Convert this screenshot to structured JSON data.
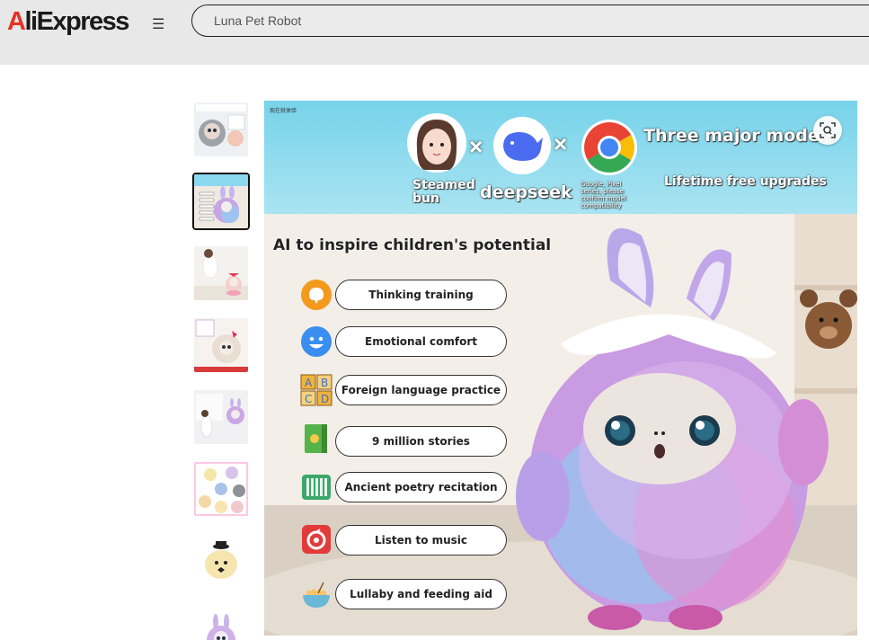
{
  "header": {
    "logo_text": "AliExpress",
    "menu_icon": "hamburger-menu-icon",
    "search_value": "Luna Pet Robot"
  },
  "gallery": {
    "selected_index": 1,
    "thumbnail_count": 8
  },
  "product_image": {
    "tiny_tag": "现在就体验",
    "character_name": "Steamed bun",
    "brand_name": "deepseek",
    "google_note": "Google, Pixel series, please confirm model compatibility",
    "models_title": "Three major models",
    "models_subtitle": "Lifetime free upgrades",
    "headline": "AI to inspire children's potential",
    "features": [
      {
        "label": "Thinking training",
        "icon": "brain-icon",
        "color": "#f39a1e"
      },
      {
        "label": "Emotional comfort",
        "icon": "smiley-icon",
        "color": "#3a8ef0"
      },
      {
        "label": "Foreign language practice",
        "icon": "abcd-blocks-icon",
        "color": "#f0b33b"
      },
      {
        "label": "9 million stories",
        "icon": "book-icon",
        "color": "#56b34a"
      },
      {
        "label": "Ancient poetry recitation",
        "icon": "bamboo-scroll-icon",
        "color": "#3aa86b"
      },
      {
        "label": "Listen to music",
        "icon": "music-app-icon",
        "color": "#e23b3b"
      },
      {
        "label": "Lullaby and feeding aid",
        "icon": "bowl-icon",
        "color": "#6ab8d8"
      }
    ],
    "lens_icon": "image-search-icon"
  }
}
